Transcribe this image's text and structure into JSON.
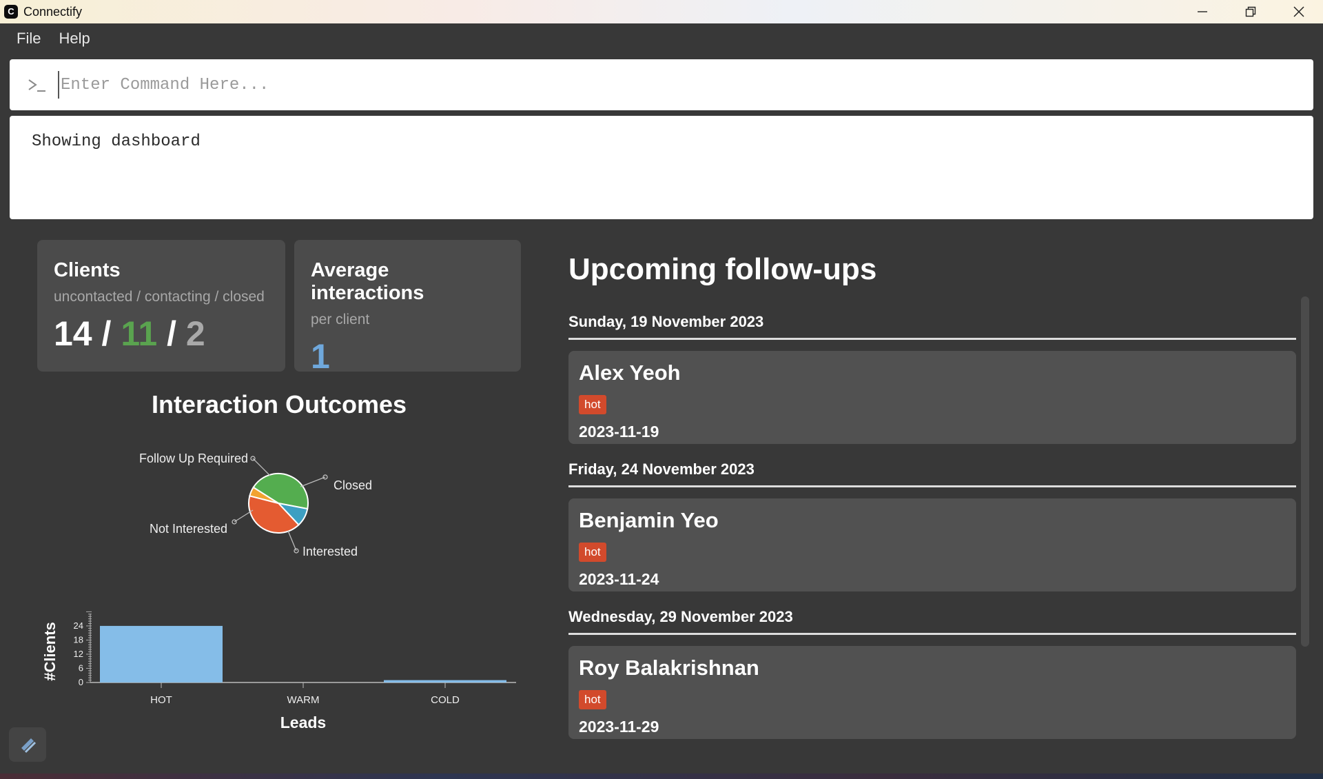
{
  "window": {
    "title": "Connectify",
    "app_icon_glyph": "C"
  },
  "menu": {
    "items": [
      "File",
      "Help"
    ]
  },
  "command": {
    "placeholder": "Enter Command Here...",
    "value": ""
  },
  "result": {
    "text": "Showing dashboard"
  },
  "stats": {
    "clients": {
      "title": "Clients",
      "subtitle": "uncontacted / contacting / closed",
      "uncontacted": "14",
      "contacting": "11",
      "closed": "2",
      "sep": "/"
    },
    "avg": {
      "title": "Average interactions",
      "subtitle": "per client",
      "value": "1"
    }
  },
  "pie": {
    "title": "Interaction Outcomes",
    "labels": {
      "follow_up": "Follow Up Required",
      "closed": "Closed",
      "not_interested": "Not Interested",
      "interested": "Interested"
    }
  },
  "chart_data": {
    "type": "bar",
    "categories": [
      "HOT",
      "WARM",
      "COLD"
    ],
    "values": [
      24,
      0,
      1
    ],
    "xlabel": "Leads",
    "ylabel": "#Clients",
    "yticks": [
      0,
      6,
      12,
      18,
      24
    ],
    "ylim": [
      0,
      30
    ],
    "bar_color": "#85bde8"
  },
  "pie_data": {
    "type": "pie",
    "slices": [
      {
        "name": "Follow Up Required",
        "value": 44,
        "color": "#54ad4f"
      },
      {
        "name": "Closed",
        "value": 10,
        "color": "#3d9fc2"
      },
      {
        "name": "Interested",
        "value": 41,
        "color": "#e45b31"
      },
      {
        "name": "Not Interested",
        "value": 5,
        "color": "#f2a331"
      }
    ]
  },
  "followups": {
    "title": "Upcoming follow-ups",
    "groups": [
      {
        "date": "Sunday, 19 November 2023",
        "name": "Alex Yeoh",
        "tag": "hot",
        "day": "2023-11-19"
      },
      {
        "date": "Friday, 24 November 2023",
        "name": "Benjamin Yeo",
        "tag": "hot",
        "day": "2023-11-24"
      },
      {
        "date": "Wednesday, 29 November 2023",
        "name": "Roy Balakrishnan",
        "tag": "hot",
        "day": "2023-11-29"
      }
    ]
  },
  "colors": {
    "background": "#383838",
    "card": "#4b4b4b",
    "tag_hot": "#d24a2c",
    "accent_green": "#5aa34f",
    "accent_blue": "#6fa8dc"
  }
}
